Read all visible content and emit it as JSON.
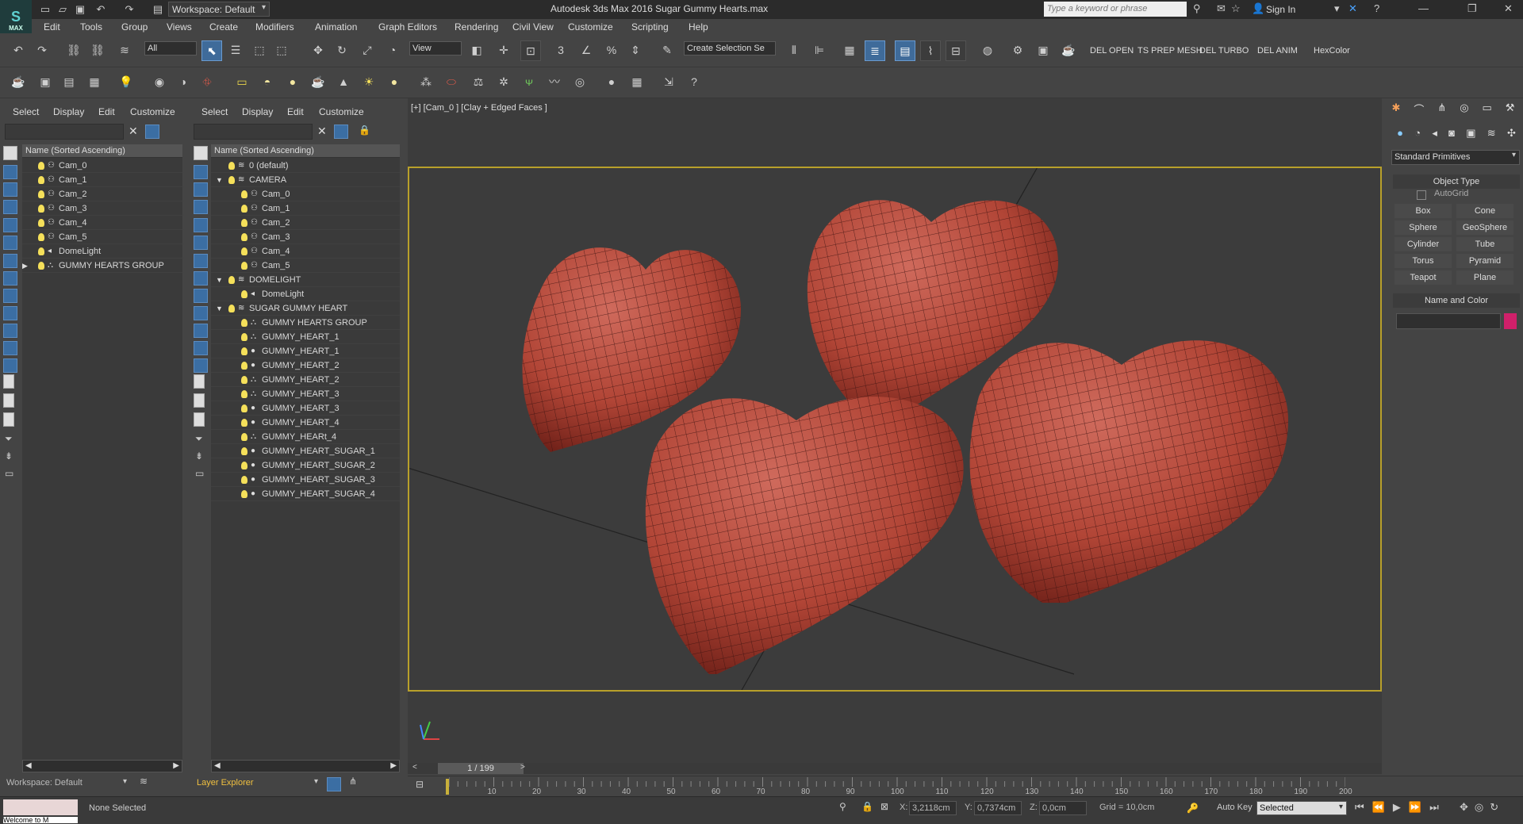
{
  "titlebar": {
    "app_title": "Autodesk 3ds Max 2016    Sugar Gummy Hearts.max",
    "workspace": "Workspace: Default",
    "search_placeholder": "Type a keyword or phrase",
    "sign_in": "Sign In",
    "logo": "MAX"
  },
  "menu": [
    "Edit",
    "Tools",
    "Group",
    "Views",
    "Create",
    "Modifiers",
    "Animation",
    "Graph Editors",
    "Rendering",
    "Civil View",
    "Customize",
    "Scripting",
    "Help"
  ],
  "toolbar": {
    "filter_all": "All",
    "ref_coord": "View",
    "selection_set": "Create Selection Se",
    "script_buttons": [
      "DEL OPEN",
      "TS PREP MESH",
      "DEL TURBO",
      "DEL ANIM",
      "HexColor"
    ]
  },
  "scene_explorer": {
    "tabs": [
      "Select",
      "Display",
      "Edit",
      "Customize"
    ],
    "column": "Name (Sorted Ascending)",
    "items": [
      "Cam_0",
      "Cam_1",
      "Cam_2",
      "Cam_3",
      "Cam_4",
      "Cam_5",
      "DomeLight",
      "GUMMY HEARTS GROUP"
    ],
    "workspace": "Workspace: Default"
  },
  "layer_explorer": {
    "tabs": [
      "Select",
      "Display",
      "Edit",
      "Customize"
    ],
    "column": "Name (Sorted Ascending)",
    "items": [
      {
        "level": 0,
        "label": "0 (default)",
        "type": "layer"
      },
      {
        "level": 0,
        "label": "CAMERA",
        "type": "layer",
        "open": true
      },
      {
        "level": 1,
        "label": "Cam_0",
        "type": "cam"
      },
      {
        "level": 1,
        "label": "Cam_1",
        "type": "cam"
      },
      {
        "level": 1,
        "label": "Cam_2",
        "type": "cam"
      },
      {
        "level": 1,
        "label": "Cam_3",
        "type": "cam"
      },
      {
        "level": 1,
        "label": "Cam_4",
        "type": "cam"
      },
      {
        "level": 1,
        "label": "Cam_5",
        "type": "cam"
      },
      {
        "level": 0,
        "label": "DOMELIGHT",
        "type": "layer",
        "open": true
      },
      {
        "level": 1,
        "label": "DomeLight",
        "type": "light"
      },
      {
        "level": 0,
        "label": "SUGAR GUMMY HEART",
        "type": "layer",
        "open": true
      },
      {
        "level": 1,
        "label": "GUMMY HEARTS GROUP",
        "type": "group"
      },
      {
        "level": 1,
        "label": "GUMMY_HEART_1",
        "type": "group"
      },
      {
        "level": 1,
        "label": "GUMMY_HEART_1",
        "type": "obj"
      },
      {
        "level": 1,
        "label": "GUMMY_HEART_2",
        "type": "obj"
      },
      {
        "level": 1,
        "label": "GUMMY_HEART_2",
        "type": "group"
      },
      {
        "level": 1,
        "label": "GUMMY_HEART_3",
        "type": "group"
      },
      {
        "level": 1,
        "label": "GUMMY_HEART_3",
        "type": "obj"
      },
      {
        "level": 1,
        "label": "GUMMY_HEART_4",
        "type": "obj"
      },
      {
        "level": 1,
        "label": "GUMMY_HEARt_4",
        "type": "group"
      },
      {
        "level": 1,
        "label": "GUMMY_HEART_SUGAR_1",
        "type": "obj"
      },
      {
        "level": 1,
        "label": "GUMMY_HEART_SUGAR_2",
        "type": "obj"
      },
      {
        "level": 1,
        "label": "GUMMY_HEART_SUGAR_3",
        "type": "obj"
      },
      {
        "level": 1,
        "label": "GUMMY_HEART_SUGAR_4",
        "type": "obj"
      }
    ],
    "footer": "Layer Explorer"
  },
  "viewport": {
    "label": "[+] [Cam_0 ] [Clay + Edged Faces ]",
    "heart_color": "#b84a3c"
  },
  "command_panel": {
    "category": "Standard Primitives",
    "object_type_title": "Object Type",
    "autogrid": "AutoGrid",
    "buttons": [
      "Box",
      "Cone",
      "Sphere",
      "GeoSphere",
      "Cylinder",
      "Tube",
      "Torus",
      "Pyramid",
      "Teapot",
      "Plane"
    ],
    "name_color_title": "Name and Color",
    "swatch_color": "#d0206a"
  },
  "timeline": {
    "frame": "1 / 199",
    "ticks": [
      "10",
      "20",
      "30",
      "40",
      "50",
      "60",
      "70",
      "80",
      "90",
      "100",
      "110",
      "120",
      "130",
      "140",
      "150",
      "160",
      "170",
      "180",
      "190",
      "200"
    ]
  },
  "status": {
    "selection": "None Selected",
    "x_label": "X:",
    "x": "3,2118cm",
    "y_label": "Y:",
    "y": "0,7374cm",
    "z_label": "Z:",
    "z": "0,0cm",
    "grid": "Grid = 10,0cm",
    "auto_key": "Auto Key",
    "key_mode": "Selected",
    "maxscript": "Welcome to M"
  }
}
